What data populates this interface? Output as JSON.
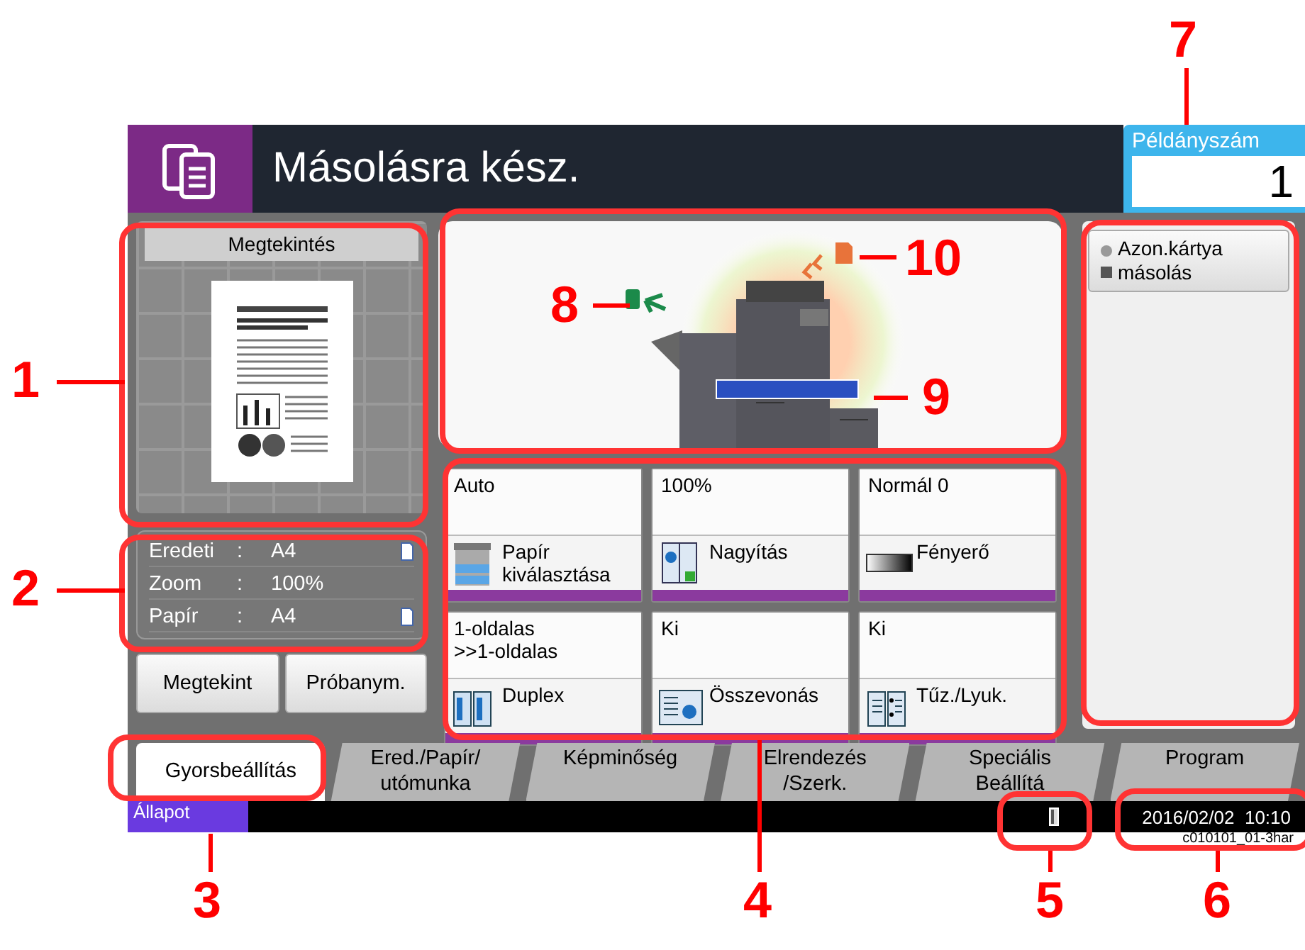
{
  "header": {
    "title": "Másolásra kész.",
    "copies_label": "Példányszám",
    "copies_value": "1"
  },
  "preview": {
    "title": "Megtekintés"
  },
  "original_info": [
    {
      "label": "Eredeti",
      "separator": ":",
      "value": "A4",
      "kind": "paper"
    },
    {
      "label": "Zoom",
      "separator": ":",
      "value": "100%",
      "kind": "plain"
    },
    {
      "label": "Papír",
      "separator": ":",
      "value": "A4",
      "kind": "paper"
    }
  ],
  "preview_buttons": [
    "Megtekint",
    "Próbanym."
  ],
  "functions": [
    {
      "value": "Auto",
      "label": "Papír\nkiválasztása",
      "kind": "tray"
    },
    {
      "value": "100%",
      "label": "Nagyítás",
      "kind": "zoom"
    },
    {
      "value": "Normál 0",
      "label": "Fényerő",
      "kind": "density"
    },
    {
      "value": "1-oldalas\n>>1-oldalas",
      "label": "Duplex",
      "kind": "duplex"
    },
    {
      "value": "Ki",
      "label": "Összevonás",
      "kind": "combine"
    },
    {
      "value": "Ki",
      "label": "Tűz./Lyuk.",
      "kind": "staple"
    }
  ],
  "side_buttons": [
    {
      "label": "Azon.kártya\nmásolás"
    }
  ],
  "tabs": [
    {
      "label": "Gyorsbeállítás",
      "selected": true
    },
    {
      "label": "Ered./Papír/\nutómunka",
      "selected": false
    },
    {
      "label": "Képminőség",
      "selected": false
    },
    {
      "label": "Elrendezés\n/Szerk.",
      "selected": false
    },
    {
      "label": "Speciális\nBeállítá",
      "selected": false
    },
    {
      "label": "Program",
      "selected": false
    }
  ],
  "status_bar": {
    "status": "Állapot",
    "datetime": "2016/02/02  10:10",
    "code": "c010101_01-3har"
  },
  "callouts": [
    {
      "number": "1"
    },
    {
      "number": "2"
    },
    {
      "number": "3"
    },
    {
      "number": "4"
    },
    {
      "number": "5"
    },
    {
      "number": "6"
    },
    {
      "number": "7"
    },
    {
      "number": "8"
    },
    {
      "number": "9"
    },
    {
      "number": "10"
    }
  ]
}
